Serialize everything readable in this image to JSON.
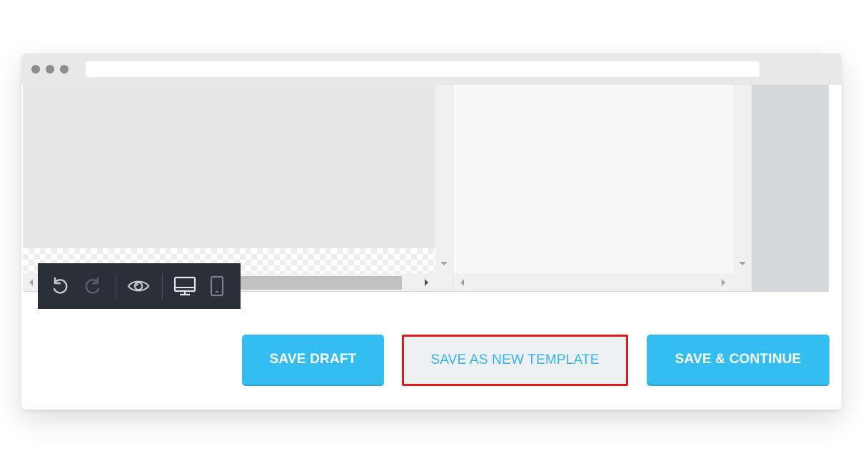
{
  "window": {
    "chrome_dots": [
      "close-dot",
      "minimize-dot",
      "maximize-dot"
    ],
    "url": ""
  },
  "toolbar": {
    "items": [
      {
        "name": "undo-icon",
        "enabled": true
      },
      {
        "name": "redo-icon",
        "enabled": false
      },
      {
        "name": "eye-icon",
        "enabled": true
      },
      {
        "name": "desktop-icon",
        "enabled": true,
        "active": true
      },
      {
        "name": "mobile-icon",
        "enabled": true
      }
    ]
  },
  "actions": {
    "save_draft_label": "SAVE DRAFT",
    "save_template_label": "SAVE AS NEW TEMPLATE",
    "save_continue_label": "SAVE & CONTINUE"
  },
  "colors": {
    "primary_button": "#33bdf0",
    "secondary_button_text": "#33b4e6",
    "highlight_border": "#e01a1a",
    "toolbar_bg": "#2b2f3a"
  }
}
